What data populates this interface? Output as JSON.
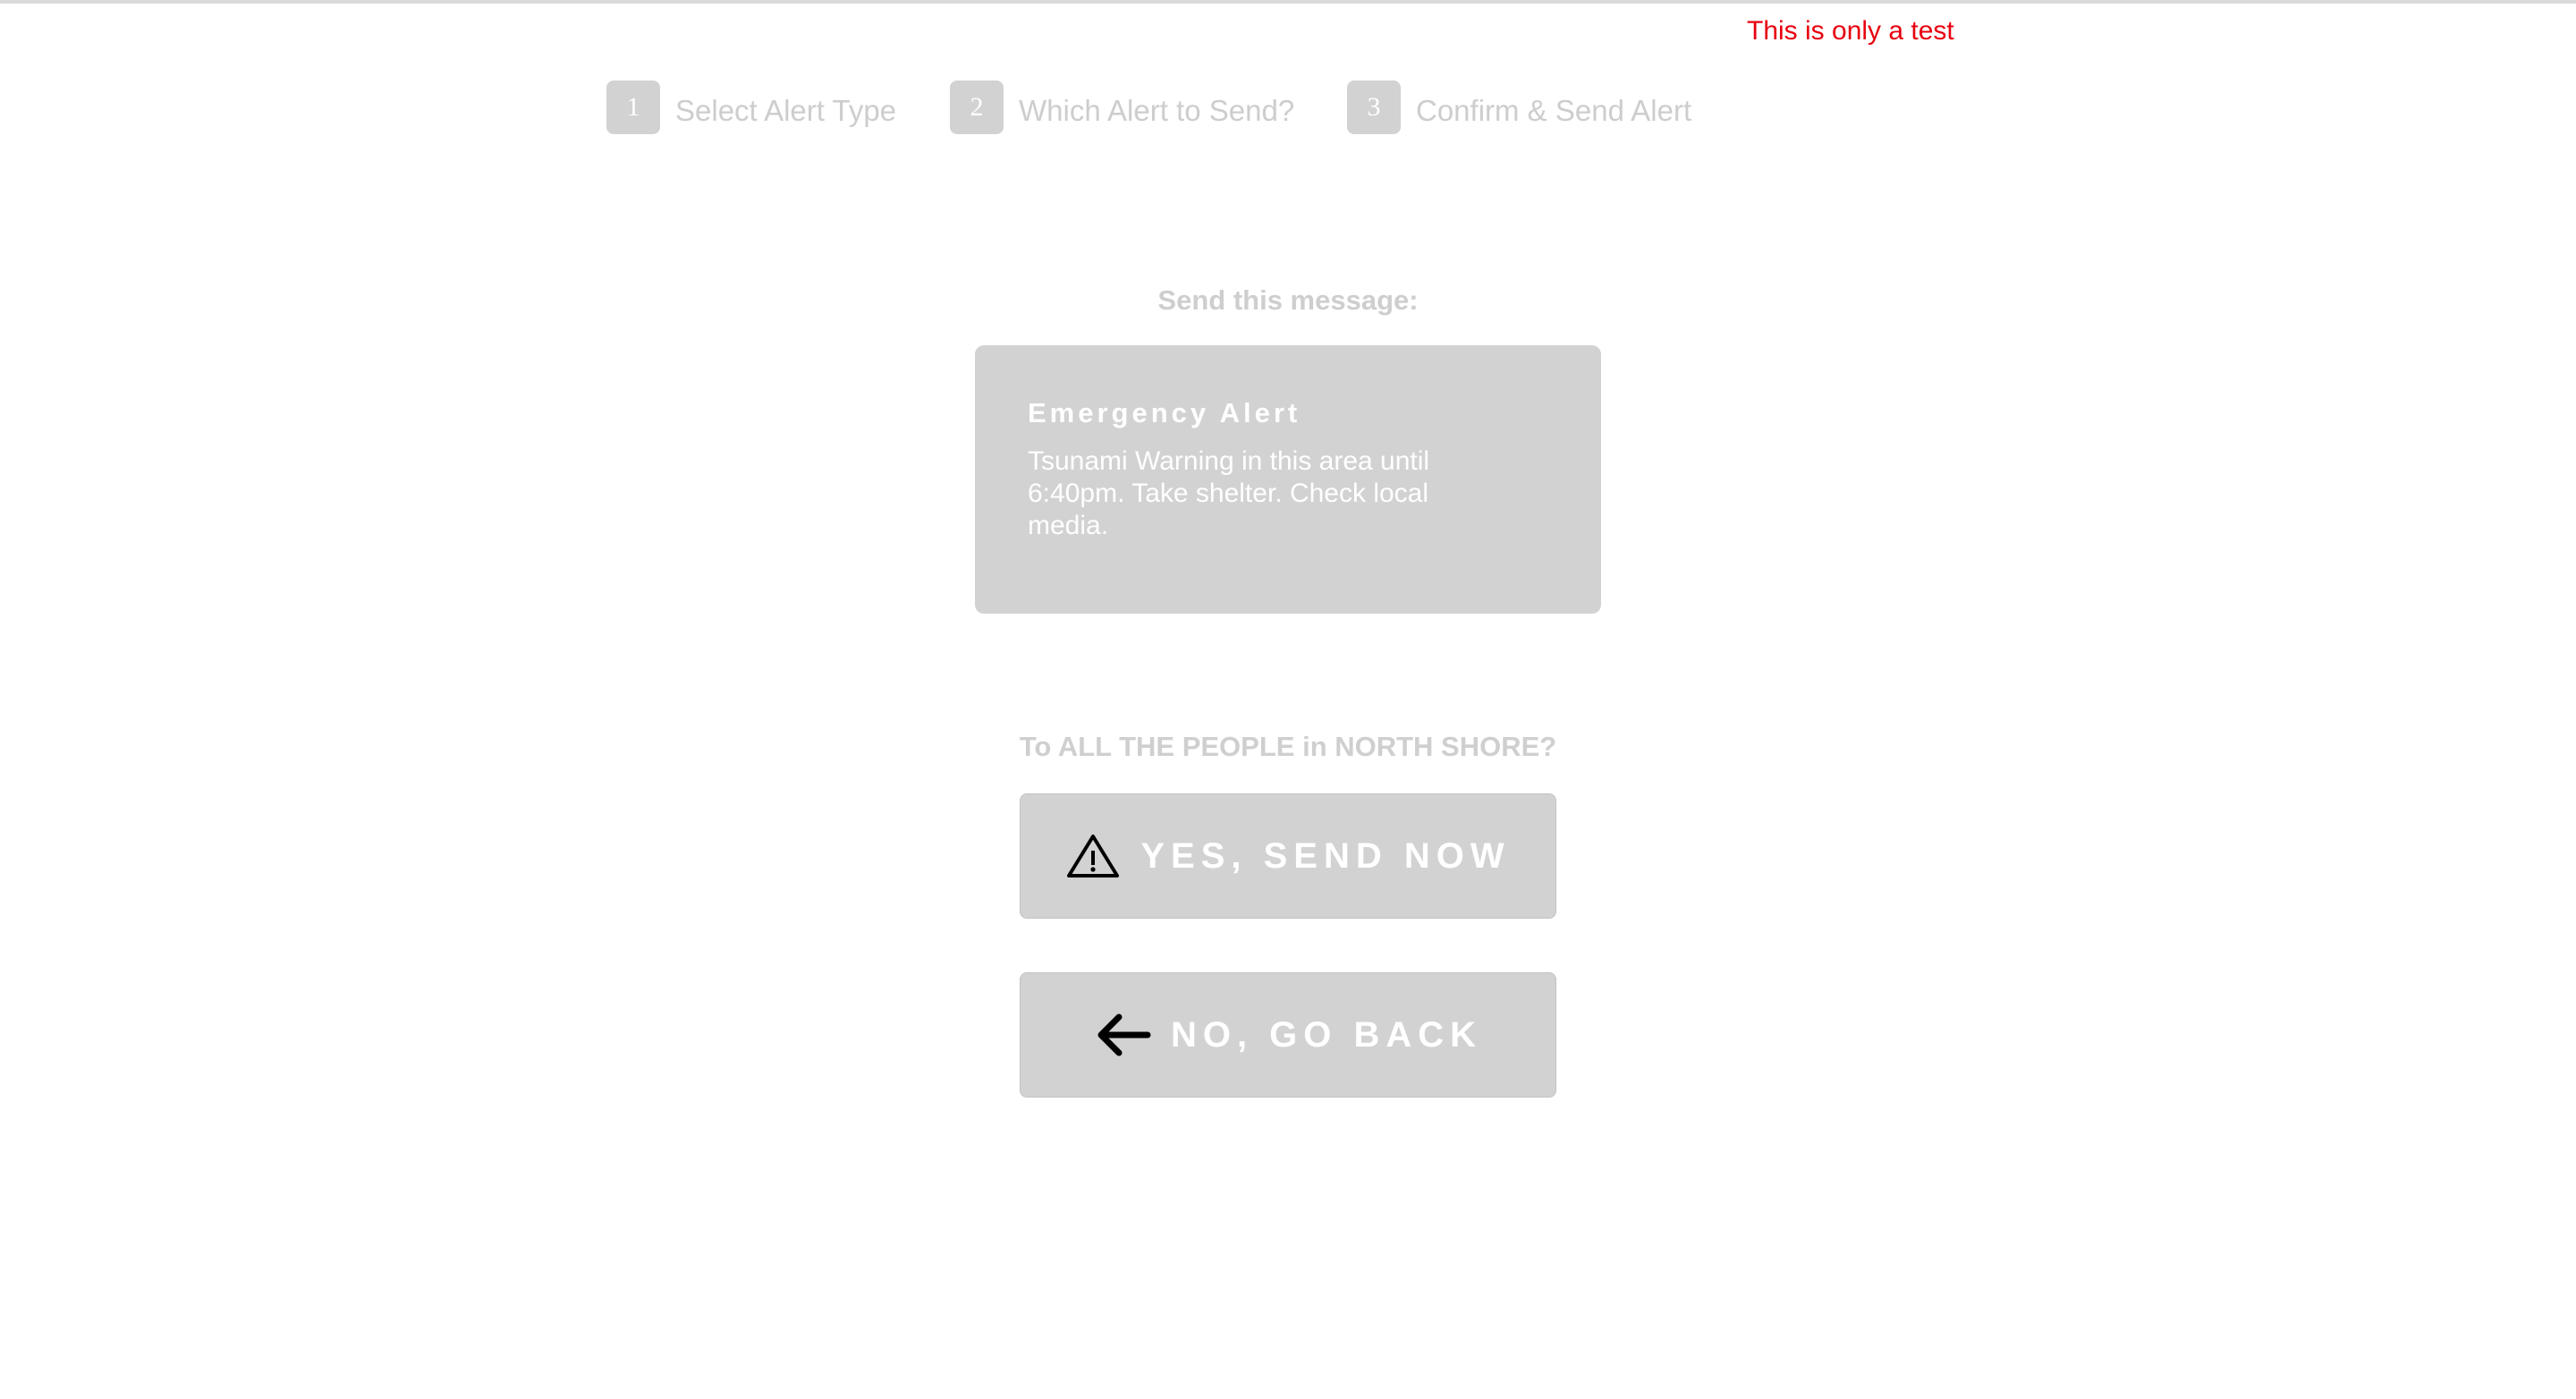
{
  "banner": {
    "test_notice": "This is only a test"
  },
  "steps": [
    {
      "number": "1",
      "label": "Select Alert Type"
    },
    {
      "number": "2",
      "label": "Which Alert to Send?"
    },
    {
      "number": "3",
      "label": "Confirm & Send Alert"
    }
  ],
  "confirm": {
    "prompt": "Send this message:",
    "message": {
      "title": "Emergency Alert",
      "body": "Tsunami Warning in this area until 6:40pm. Take shelter. Check local media."
    },
    "recipients_question": "To ALL THE PEOPLE in NORTH SHORE?"
  },
  "actions": {
    "send_label": "YES, SEND NOW",
    "send_icon": "warning-triangle-icon",
    "back_label": "NO, GO BACK",
    "back_icon": "arrow-left-icon"
  },
  "colors": {
    "test_notice": "#e8000e",
    "disabled_fill": "#d2d2d2",
    "muted_text": "#cdcdcd"
  }
}
